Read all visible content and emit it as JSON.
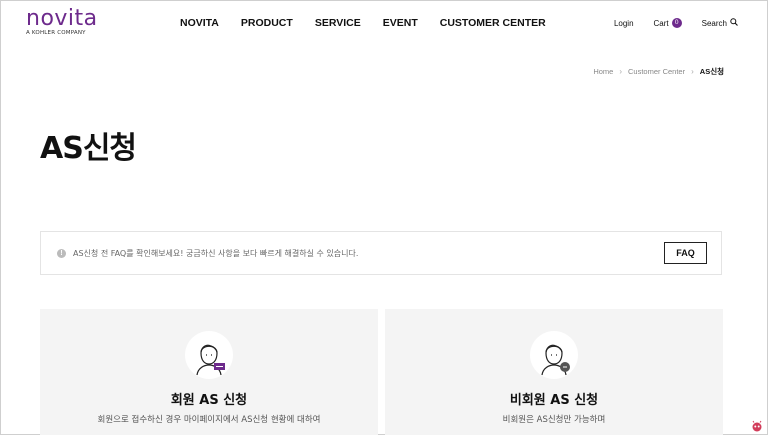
{
  "header": {
    "logo_text": "novita",
    "logo_sub": "A KOHLER COMPANY",
    "nav": [
      "NOVITA",
      "PRODUCT",
      "SERVICE",
      "EVENT",
      "CUSTOMER CENTER"
    ],
    "login": "Login",
    "cart": "Cart",
    "cart_count": "0",
    "search": "Search"
  },
  "breadcrumb": [
    "Home",
    "Customer Center",
    "AS신청"
  ],
  "page_title": "AS신청",
  "notice": {
    "icon": "info-icon",
    "text": "AS신청 전 FAQ를 확인해보세요! 궁금하신 사항을 보다 빠르게 해결하실 수 있습니다.",
    "button": "FAQ"
  },
  "cards": [
    {
      "title": "회원 AS 신청",
      "desc": "회원으로 접수하신 경우 마이페이지에서 AS신청 현황에 대하여",
      "icon": "member-avatar-icon"
    },
    {
      "title": "비회원 AS 신청",
      "desc": "비회원은 AS신청만 가능하며",
      "icon": "guest-avatar-icon"
    }
  ],
  "colors": {
    "brand": "#6d2a8c",
    "card_bg": "#f4f4f4"
  }
}
